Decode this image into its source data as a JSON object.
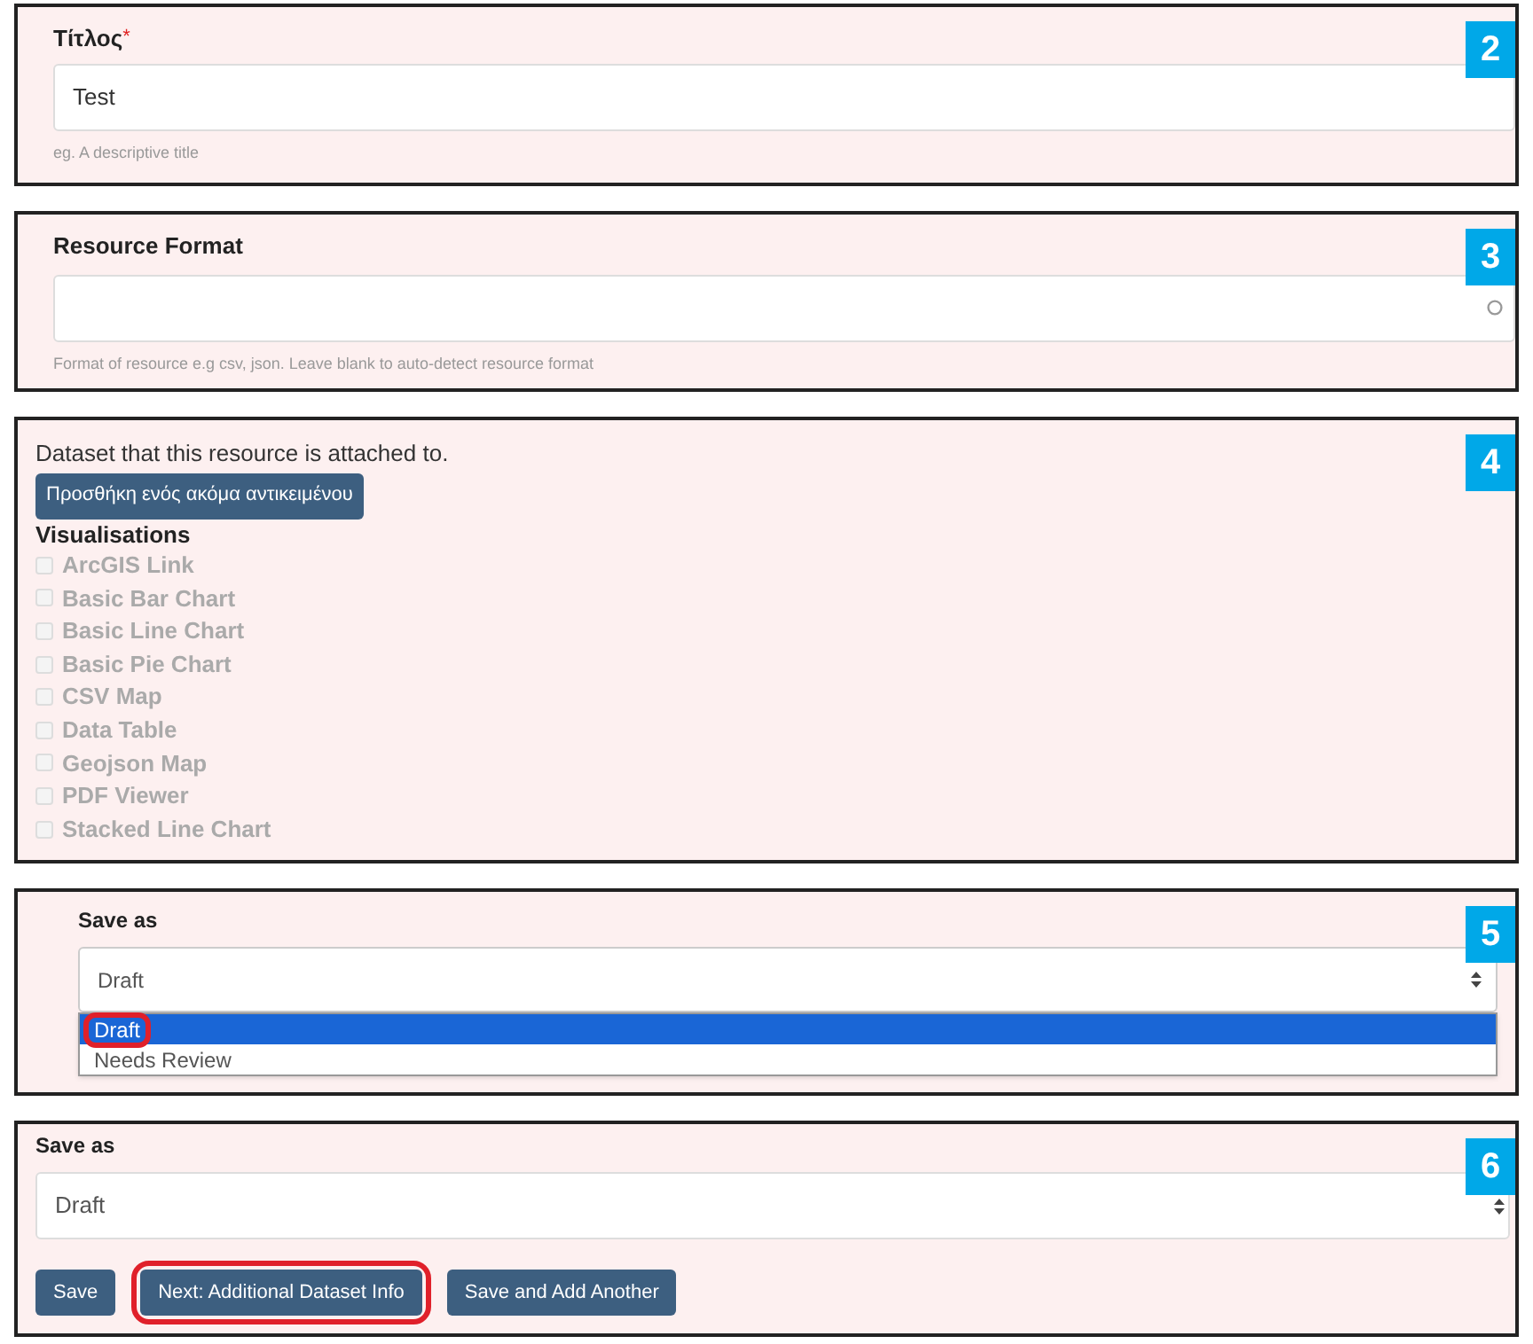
{
  "title_panel": {
    "badge": "2",
    "label": "Τίτλος",
    "required_mark": "*",
    "value": "Test",
    "help": "eg. A descriptive title"
  },
  "format_panel": {
    "badge": "3",
    "label": "Resource Format",
    "help": "Format of resource e.g csv, json. Leave blank to auto-detect resource format"
  },
  "dataset_panel": {
    "badge": "4",
    "description": "Dataset that this resource is attached to.",
    "add_button": "Προσθήκη ενός ακόμα αντικειμένου",
    "visualisations_label": "Visualisations",
    "visualisations": [
      {
        "label": "ArcGIS Link",
        "checked": false,
        "disabled": true
      },
      {
        "label": "Basic Bar Chart",
        "checked": false,
        "disabled": true
      },
      {
        "label": "Basic Line Chart",
        "checked": false,
        "disabled": true
      },
      {
        "label": "Basic Pie Chart",
        "checked": false,
        "disabled": true
      },
      {
        "label": "CSV Map",
        "checked": false,
        "disabled": true
      },
      {
        "label": "Data Table",
        "checked": false,
        "disabled": true
      },
      {
        "label": "Geojson Map",
        "checked": false,
        "disabled": true
      },
      {
        "label": "PDF Viewer",
        "checked": false,
        "disabled": true
      },
      {
        "label": "Stacked Line Chart",
        "checked": false,
        "disabled": true
      }
    ]
  },
  "save_dropdown_panel": {
    "badge": "5",
    "label": "Save as",
    "value": "Draft",
    "options": [
      {
        "label": "Draft",
        "selected": true,
        "highlighted": true
      },
      {
        "label": "Needs Review",
        "selected": false,
        "highlighted": false
      }
    ]
  },
  "save_panel": {
    "badge": "6",
    "label": "Save as",
    "value": "Draft",
    "buttons": [
      {
        "label": "Save",
        "highlighted": false
      },
      {
        "label": "Next: Additional Dataset Info",
        "highlighted": true
      },
      {
        "label": "Save and Add Another",
        "highlighted": false
      }
    ]
  }
}
